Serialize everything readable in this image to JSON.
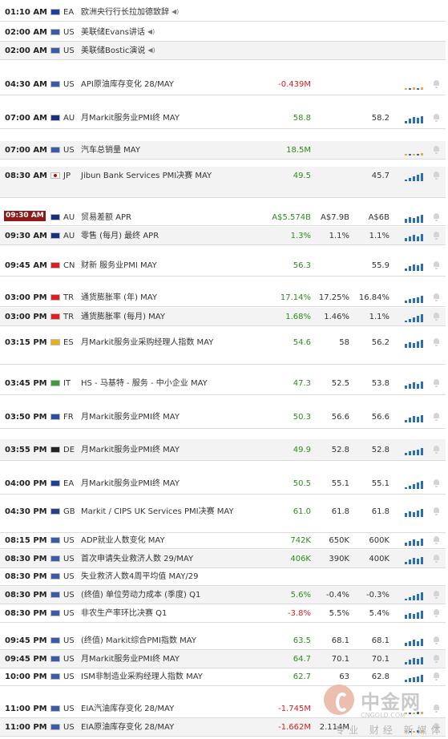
{
  "colors": {
    "positive": "#2e8b1e",
    "negative": "#d62020",
    "highlight_time": "#8b1a1a",
    "bar_blue": "#2a6fb5",
    "bar_orange": "#f0a64a"
  },
  "events": [
    {
      "time": "01:10 AM",
      "country": "EA",
      "flag": "eu-flag",
      "event": "欧洲央行行长拉加德致辞",
      "speech": true
    },
    {
      "time": "02:00 AM",
      "country": "US",
      "flag": "us-flag",
      "event": "美联储Evans讲话",
      "speech": true
    },
    {
      "time": "02:00 AM",
      "country": "US",
      "flag": "us-flag",
      "event": "美联储Bostic演说",
      "speech": true
    },
    {
      "time": "04:30 AM",
      "country": "US",
      "flag": "us-flag",
      "event": "API原油库存变化 28/MAY",
      "actual": "-0.439M",
      "tone": "neg",
      "forecast": "",
      "previous": ""
    },
    {
      "time": "07:00 AM",
      "country": "AU",
      "flag": "au-flag",
      "event": "月Markit服务业PMI终 MAY",
      "actual": "58.8",
      "tone": "pos",
      "forecast": "",
      "previous": "58.2"
    },
    {
      "time": "07:00 AM",
      "country": "US",
      "flag": "us-flag",
      "event": "汽车总销量 MAY",
      "actual": "18.5M",
      "tone": "pos",
      "forecast": "",
      "previous": ""
    },
    {
      "time": "08:30 AM",
      "country": "JP",
      "flag": "jp-flag",
      "event": "Jibun Bank Services PMI决赛 MAY",
      "actual": "49.5",
      "tone": "pos",
      "forecast": "",
      "previous": "45.7"
    },
    {
      "time": "09:30 AM",
      "country": "AU",
      "flag": "au-flag",
      "event": "贸易差额 APR",
      "actual": "A$5.574B",
      "tone": "pos",
      "forecast": "A$7.9B",
      "previous": "A$6B",
      "highlight": true
    },
    {
      "time": "09:30 AM",
      "country": "AU",
      "flag": "au-flag",
      "event": "零售 (每月) 最终 APR",
      "actual": "1.3%",
      "tone": "pos",
      "forecast": "1.1%",
      "previous": "1.1%"
    },
    {
      "time": "09:45 AM",
      "country": "CN",
      "flag": "cn-flag",
      "event": "财新 服务业PMI MAY",
      "actual": "56.3",
      "tone": "pos",
      "forecast": "",
      "previous": "55.9"
    },
    {
      "time": "03:00 PM",
      "country": "TR",
      "flag": "tr-flag",
      "event": "通货膨胀率 (年) MAY",
      "actual": "17.14%",
      "tone": "pos",
      "forecast": "17.25%",
      "previous": "16.84%"
    },
    {
      "time": "03:00 PM",
      "country": "TR",
      "flag": "tr-flag",
      "event": "通货膨胀率 (每月) MAY",
      "actual": "1.68%",
      "tone": "pos",
      "forecast": "1.46%",
      "previous": "1.1%"
    },
    {
      "time": "03:15 PM",
      "country": "ES",
      "flag": "es-flag",
      "event": "月Markit服务业采购经理人指数 MAY",
      "actual": "54.6",
      "tone": "pos",
      "forecast": "58",
      "previous": "56.2"
    },
    {
      "time": "03:45 PM",
      "country": "IT",
      "flag": "it-flag",
      "event": "HS - 马基特 - 服务 - 中小企业 MAY",
      "actual": "47.3",
      "tone": "pos",
      "forecast": "52.5",
      "previous": "53.8"
    },
    {
      "time": "03:50 PM",
      "country": "FR",
      "flag": "fr-flag",
      "event": "月Markit服务业PMI终 MAY",
      "actual": "50.3",
      "tone": "pos",
      "forecast": "56.6",
      "previous": "56.6"
    },
    {
      "time": "03:55 PM",
      "country": "DE",
      "flag": "de-flag",
      "event": "月Markit服务业PMI终 MAY",
      "actual": "49.9",
      "tone": "pos",
      "forecast": "52.8",
      "previous": "52.8"
    },
    {
      "time": "04:00 PM",
      "country": "EA",
      "flag": "eu-flag",
      "event": "月Markit服务业PMI终 MAY",
      "actual": "50.5",
      "tone": "pos",
      "forecast": "55.1",
      "previous": "55.1"
    },
    {
      "time": "04:30 PM",
      "country": "GB",
      "flag": "gb-flag",
      "event": "Markit / CIPS UK Services PMI决赛 MAY",
      "actual": "61.0",
      "tone": "pos",
      "forecast": "61.8",
      "previous": "61.8"
    },
    {
      "time": "08:15 PM",
      "country": "US",
      "flag": "us-flag",
      "event": "ADP就业人数变化 MAY",
      "actual": "742K",
      "tone": "pos",
      "forecast": "650K",
      "previous": "600K"
    },
    {
      "time": "08:30 PM",
      "country": "US",
      "flag": "us-flag",
      "event": "首次申请失业救济人数 29/MAY",
      "actual": "406K",
      "tone": "pos",
      "forecast": "390K",
      "previous": "400K"
    },
    {
      "time": "08:30 PM",
      "country": "US",
      "flag": "us-flag",
      "event": "失业救济人数4周平均值 MAY/29",
      "actual": "",
      "tone": "neu",
      "forecast": "",
      "previous": ""
    },
    {
      "time": "08:30 PM",
      "country": "US",
      "flag": "us-flag",
      "event": "(终值) 单位劳动力成本 (季度) Q1",
      "actual": "5.6%",
      "tone": "pos",
      "forecast": "-0.4%",
      "previous": "-0.3%"
    },
    {
      "time": "08:30 PM",
      "country": "US",
      "flag": "us-flag",
      "event": "非农生产率环比决赛 Q1",
      "actual": "-3.8%",
      "tone": "neg",
      "forecast": "5.5%",
      "previous": "5.4%"
    },
    {
      "time": "09:45 PM",
      "country": "US",
      "flag": "us-flag",
      "event": "(终值) Markit综合PMI指数 MAY",
      "actual": "63.5",
      "tone": "pos",
      "forecast": "68.1",
      "previous": "68.1"
    },
    {
      "time": "09:45 PM",
      "country": "US",
      "flag": "us-flag",
      "event": "月Markit服务业PMI终 MAY",
      "actual": "64.7",
      "tone": "pos",
      "forecast": "70.1",
      "previous": "70.1"
    },
    {
      "time": "10:00 PM",
      "country": "US",
      "flag": "us-flag",
      "event": "ISM非制造业采购经理人指数 MAY",
      "actual": "62.7",
      "tone": "pos",
      "forecast": "63",
      "previous": "62.8"
    },
    {
      "time": "11:00 PM",
      "country": "US",
      "flag": "us-flag",
      "event": "EIA汽油库存变化 28/MAY",
      "actual": "-1.745M",
      "tone": "neg",
      "forecast": "",
      "previous": ""
    },
    {
      "time": "11:00 PM",
      "country": "US",
      "flag": "us-flag",
      "event": "EIA原油库存变化 28/MAY",
      "actual": "-1.662M",
      "tone": "neg",
      "forecast": "2.114M",
      "previous": ""
    }
  ],
  "watermark": {
    "brand": "中金网",
    "url": "CNGOLD.COM",
    "slogan": "专业 财经 新媒体"
  }
}
